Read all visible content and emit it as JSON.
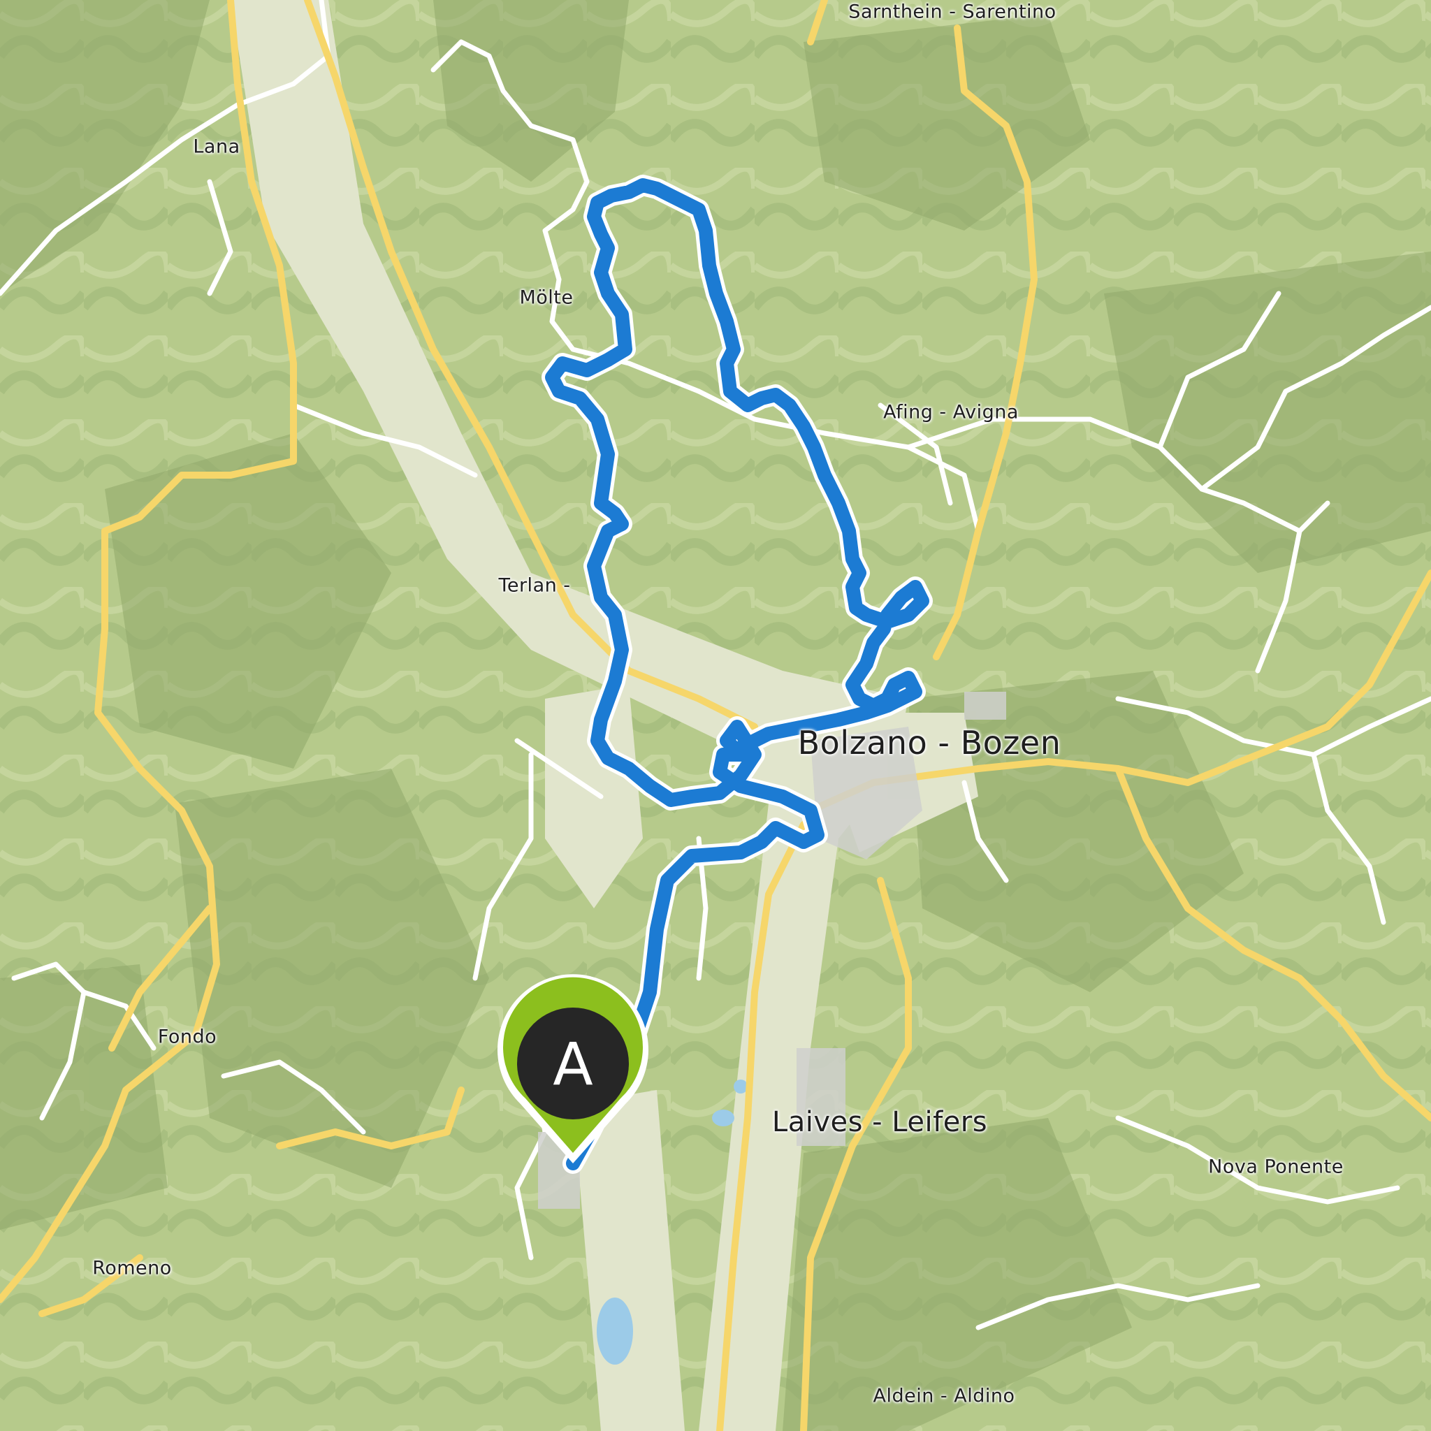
{
  "map": {
    "kind": "topographic route map",
    "colors": {
      "forest": "#b9cd8f",
      "valley": "#dfe4c8",
      "road_major": "#f6d66a",
      "road_minor": "#ffffff",
      "water": "#9ccbe8",
      "route": "#1c7bd3",
      "marker_body": "#8cbf1e",
      "marker_inner": "#262626"
    },
    "places": {
      "sarnthein": "Sarnthein - Sarentino",
      "lana": "Lana",
      "molten": "Mölte",
      "afing": "Afing - Avigna",
      "terlan": "Terlan -",
      "bolzano": "Bolzano - Bozen",
      "fondo": "Fondo",
      "laives": "Laives - Leifers",
      "nova_ponente": "Nova Ponente",
      "romeno": "Romeno",
      "aldein": "Aldein - Aldino"
    },
    "route": {
      "color": "#1c7bd3",
      "start_marker": {
        "letter": "A",
        "icon": "map-pin-start-icon"
      }
    }
  }
}
